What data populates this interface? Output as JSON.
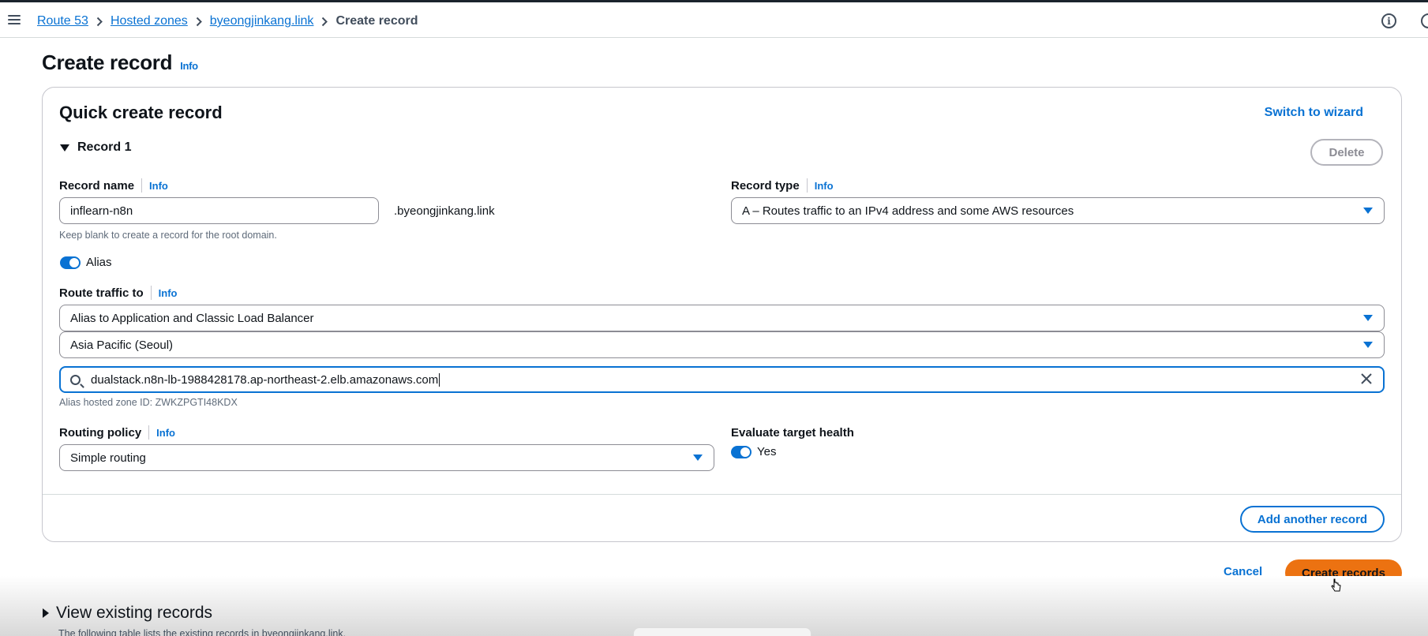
{
  "breadcrumb": {
    "items": [
      "Route 53",
      "Hosted zones",
      "byeongjinkang.link"
    ],
    "current": "Create record"
  },
  "page": {
    "title": "Create record",
    "info": "Info"
  },
  "card": {
    "title": "Quick create record",
    "switch_wizard": "Switch to wizard",
    "record_label": "Record 1",
    "delete_label": "Delete"
  },
  "record_name": {
    "label": "Record name",
    "info": "Info",
    "value": "inflearn-n8n",
    "suffix": ".byeongjinkang.link",
    "hint": "Keep blank to create a record for the root domain."
  },
  "record_type": {
    "label": "Record type",
    "info": "Info",
    "value": "A – Routes traffic to an IPv4 address and some AWS resources"
  },
  "alias": {
    "label": "Alias",
    "enabled": true
  },
  "route_traffic": {
    "label": "Route traffic to",
    "info": "Info",
    "endpoint": "Alias to Application and Classic Load Balancer",
    "region": "Asia Pacific (Seoul)",
    "target": "dualstack.n8n-lb-1988428178.ap-northeast-2.elb.amazonaws.com",
    "zone_hint": "Alias hosted zone ID: ZWKZPGTI48KDX"
  },
  "routing_policy": {
    "label": "Routing policy",
    "info": "Info",
    "value": "Simple routing"
  },
  "evaluate_health": {
    "label": "Evaluate target health",
    "value_label": "Yes",
    "enabled": true
  },
  "actions": {
    "add_another": "Add another record",
    "cancel": "Cancel",
    "create": "Create records"
  },
  "existing": {
    "title": "View existing records",
    "desc": "The following table lists the existing records in byeongjinkang.link."
  },
  "colors": {
    "link": "#0972d3",
    "primary_button": "#ec7211",
    "border": "#8c8c94"
  }
}
